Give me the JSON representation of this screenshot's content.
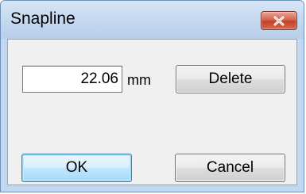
{
  "window": {
    "title": "Snapline",
    "close_icon": "close-icon"
  },
  "form": {
    "value": "22.06",
    "unit": "mm"
  },
  "buttons": {
    "delete_label": "Delete",
    "ok_label": "OK",
    "cancel_label": "Cancel"
  },
  "colors": {
    "titlebar": "#c3d7ee",
    "close_button": "#c2412a",
    "dialog_background": "#f0f0f0",
    "default_button_border": "#3c7fb1"
  }
}
